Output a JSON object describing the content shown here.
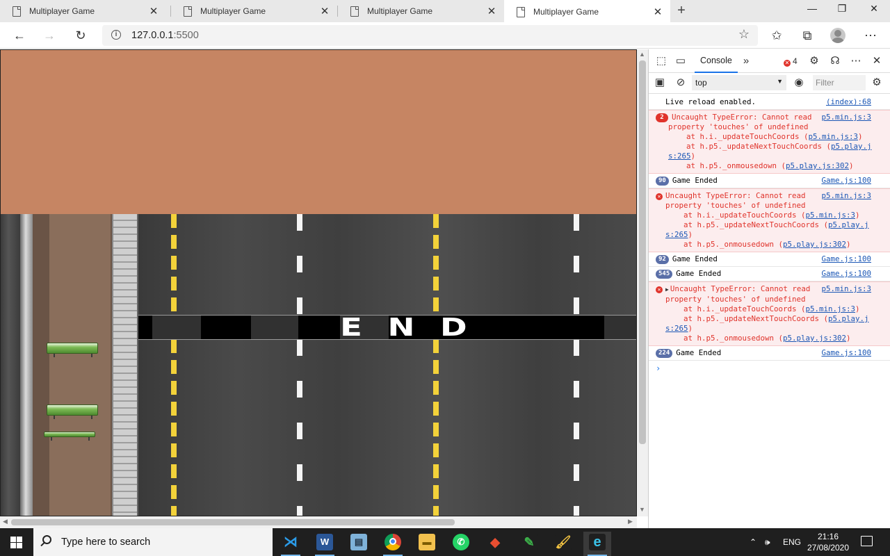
{
  "browser": {
    "tabs": [
      {
        "title": "Multiplayer Game",
        "close": "✕",
        "active": false
      },
      {
        "title": "Multiplayer Game",
        "close": "✕",
        "active": false
      },
      {
        "title": "Multiplayer Game",
        "close": "✕",
        "active": false
      },
      {
        "title": "Multiplayer Game",
        "close": "✕",
        "active": true
      }
    ],
    "new_tab": "+",
    "window_controls": {
      "minimize": "—",
      "restore": "❐",
      "close": "✕"
    },
    "nav": {
      "back": "←",
      "forward": "→",
      "reload": "↻"
    },
    "url_host": "127.0.0.1",
    "url_port": ":5500",
    "favorite_icon": "☆",
    "toolbar_icons": {
      "favorites": "✩",
      "collections": "⧉",
      "more": "⋯"
    }
  },
  "game": {
    "banner_text": "END",
    "colors": {
      "sky": "#c68563",
      "road": "#4a4a4a",
      "lane_yellow": "#f3d23a"
    }
  },
  "devtools": {
    "active_tab": "Console",
    "more_tabs": "»",
    "error_count": "4",
    "context": "top",
    "filter_placeholder": "Filter",
    "messages": [
      {
        "type": "log",
        "text": "Live reload enabled.",
        "source": "(index):68"
      },
      {
        "type": "error",
        "count": "2",
        "line1": "Uncaught TypeError: Cannot read",
        "line2": "property 'touches' of undefined",
        "line3": "at h.i._updateTouchCoords (",
        "link3": "p5.min.js:3",
        "line4": "at h.p5._updateNextTouchCoords (",
        "link4": "p5.play.j",
        "link4b": "s:265",
        "line5": "at h.p5._onmousedown (",
        "link5": "p5.play.js:302",
        "source": "p5.min.js:3"
      },
      {
        "type": "log",
        "count": "90",
        "text": "Game Ended",
        "source": "Game.js:100"
      },
      {
        "type": "error",
        "line1": "Uncaught TypeError: Cannot read",
        "line2": "property 'touches' of undefined",
        "line3": "at h.i._updateTouchCoords (",
        "link3": "p5.min.js:3",
        "line4": "at h.p5._updateNextTouchCoords (",
        "link4": "p5.play.j",
        "link4b": "s:265",
        "line5": "at h.p5._onmousedown (",
        "link5": "p5.play.js:302",
        "source": "p5.min.js:3"
      },
      {
        "type": "log",
        "count": "92",
        "text": "Game Ended",
        "source": "Game.js:100"
      },
      {
        "type": "log",
        "count": "545",
        "text": "Game Ended",
        "source": "Game.js:100"
      },
      {
        "type": "error",
        "expand": "▶",
        "line1": "Uncaught TypeError: Cannot read",
        "line2": "property 'touches' of undefined",
        "line3": "at h.i._updateTouchCoords (",
        "link3": "p5.min.js:3",
        "line4": "at h.p5._updateNextTouchCoords (",
        "link4": "p5.play.j",
        "link4b": "s:265",
        "line5": "at h.p5._onmousedown (",
        "link5": "p5.play.js:302",
        "source": "p5.min.js:3"
      },
      {
        "type": "log",
        "count": "224",
        "text": "Game Ended",
        "source": "Game.js:100"
      }
    ],
    "prompt": "›"
  },
  "taskbar": {
    "search_placeholder": "Type here to search",
    "apps": [
      "vscode-icon",
      "word-icon",
      "notepad-icon",
      "chrome-icon",
      "file-explorer-icon",
      "whatsapp-icon",
      "git-icon",
      "marker-icon",
      "paint-icon",
      "edge-icon"
    ],
    "tray_chevron": "⌃",
    "volume_icon": "🕪",
    "language": "ENG",
    "time": "21:16",
    "date": "27/08/2020"
  }
}
